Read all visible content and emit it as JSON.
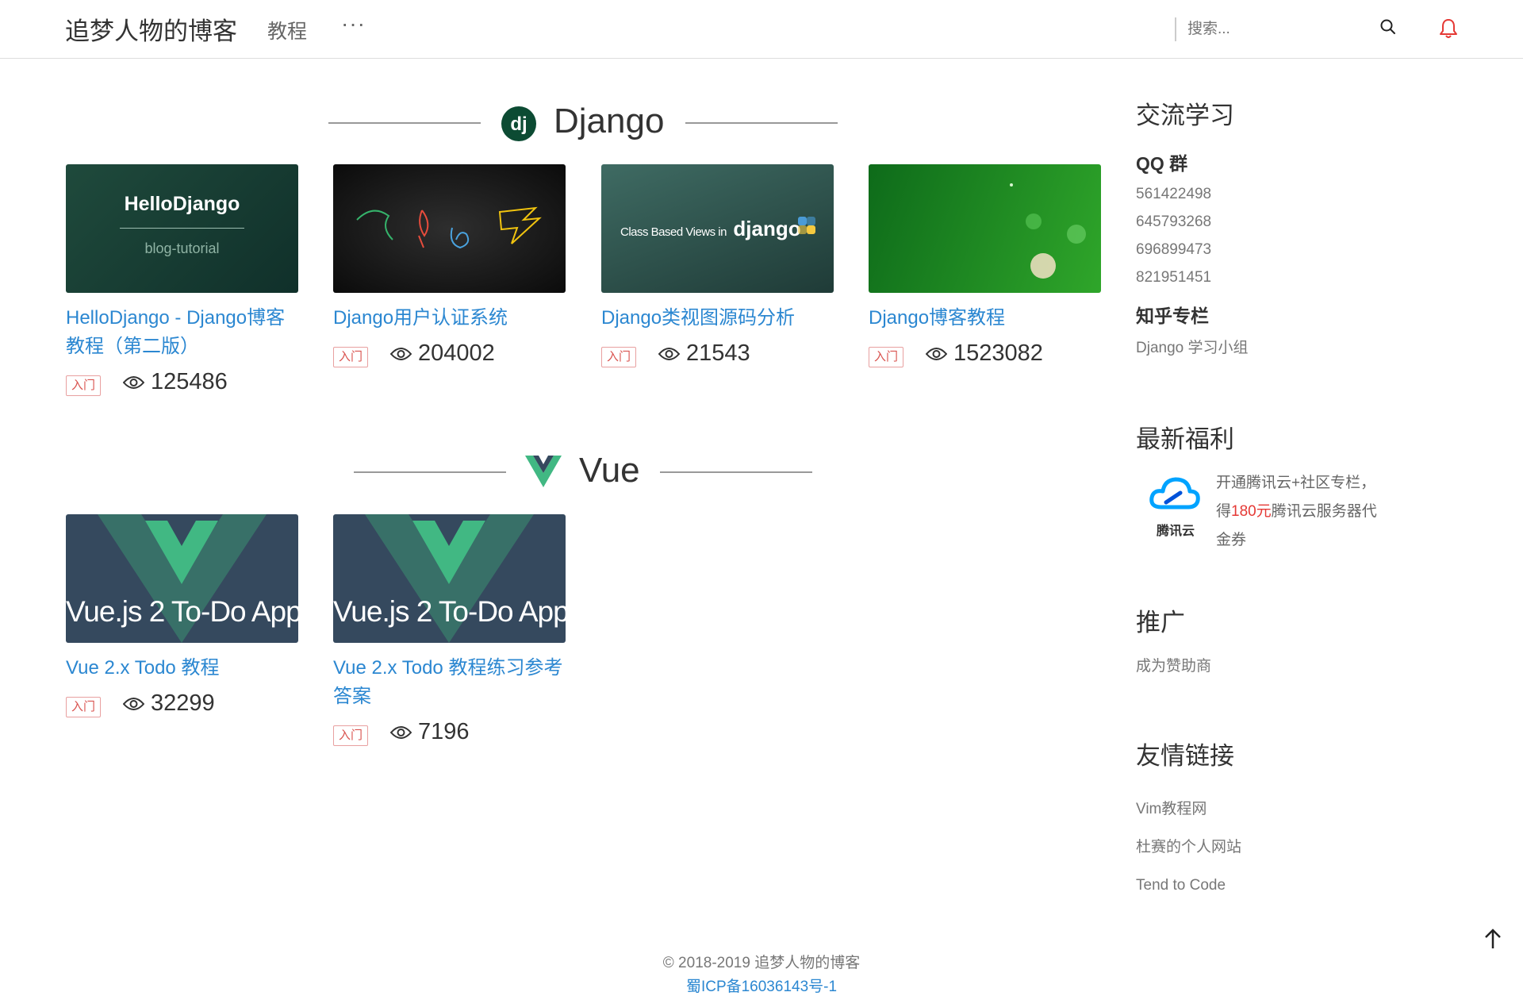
{
  "header": {
    "brand": "追梦人物的博客",
    "nav_tutorial": "教程",
    "nav_more": "···",
    "search_placeholder": "搜索..."
  },
  "sections": [
    {
      "title": "Django",
      "icon": "django-logo-icon",
      "cards": [
        {
          "thumb_title": "HelloDjango",
          "thumb_subtitle": "blog-tutorial",
          "title": "HelloDjango - Django博客教程（第二版）",
          "badge": "入门",
          "views": "125486"
        },
        {
          "title": "Django用户认证系统",
          "badge": "入门",
          "views": "204002"
        },
        {
          "thumb_text": "Class Based Views in",
          "thumb_brand": "django",
          "title": "Django类视图源码分析",
          "badge": "入门",
          "views": "21543"
        },
        {
          "title": "Django博客教程",
          "badge": "入门",
          "views": "1523082"
        }
      ]
    },
    {
      "title": "Vue",
      "icon": "vue-logo-icon",
      "cards": [
        {
          "thumb_text": "Vue.js 2 To-Do App",
          "title": "Vue 2.x Todo 教程",
          "badge": "入门",
          "views": "32299"
        },
        {
          "thumb_text": "Vue.js 2 To-Do App",
          "title": "Vue 2.x Todo 教程练习参考答案",
          "badge": "入门",
          "views": "7196"
        }
      ]
    }
  ],
  "sidebar": {
    "exchange_title": "交流学习",
    "qq_title": "QQ 群",
    "qq_groups": [
      "561422498",
      "645793268",
      "696899473",
      "821951451"
    ],
    "zhihu_title": "知乎专栏",
    "zhihu_item": "Django 学习小组",
    "welfare_title": "最新福利",
    "tencent_logo_text": "腾讯云",
    "welfare_pre": "开通腾讯云+社区专栏，得",
    "welfare_amount": "180元",
    "welfare_post": "腾讯云服务器代金券",
    "promo_title": "推广",
    "promo_link": "成为赞助商",
    "friends_title": "友情链接",
    "friends": [
      "Vim教程网",
      "杜赛的个人网站",
      "Tend to Code"
    ]
  },
  "footer": {
    "copyright": "© 2018-2019 追梦人物的博客",
    "icp": "蜀ICP备16036143号-1"
  },
  "colors": {
    "link": "#2b87d1",
    "badge": "#d9534f",
    "django_green": "#0c4b33",
    "vue_green": "#41b883",
    "vue_dark": "#35495e",
    "accent_red": "#e53935"
  }
}
